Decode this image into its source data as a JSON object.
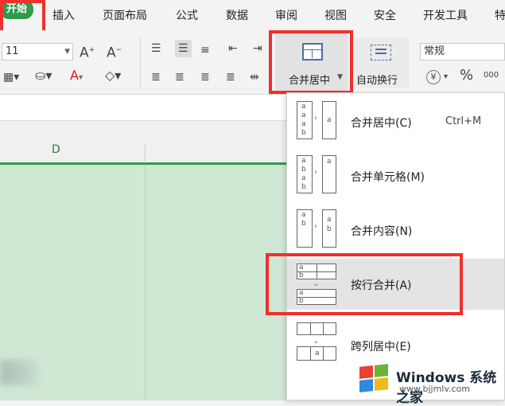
{
  "tabs": [
    {
      "id": "start",
      "label": "开始",
      "active": true
    },
    {
      "id": "insert",
      "label": "插入"
    },
    {
      "id": "layout",
      "label": "页面布局"
    },
    {
      "id": "formula",
      "label": "公式"
    },
    {
      "id": "data",
      "label": "数据"
    },
    {
      "id": "review",
      "label": "审阅"
    },
    {
      "id": "view",
      "label": "视图"
    },
    {
      "id": "security",
      "label": "安全"
    },
    {
      "id": "dev",
      "label": "开发工具"
    },
    {
      "id": "more",
      "label": "特"
    }
  ],
  "ribbon": {
    "font_size": "11",
    "number_format": "常规",
    "merge_center_label": "合并居中",
    "wrap_text_label": "自动换行",
    "percent_label": "%",
    "currency_label": "¥"
  },
  "column_header": "D",
  "menu": {
    "items": [
      {
        "label": "合并居中(C)",
        "shortcut": "Ctrl+M"
      },
      {
        "label": "合并单元格(M)",
        "shortcut": ""
      },
      {
        "label": "合并内容(N)",
        "shortcut": ""
      },
      {
        "label": "按行合并(A)",
        "shortcut": ""
      },
      {
        "label": "跨列居中(E)",
        "shortcut": ""
      }
    ],
    "icon_letters": [
      "a",
      "b"
    ]
  },
  "watermark": {
    "title": "Windows 系统之家",
    "url": "www.bjjmlv.com"
  },
  "colors": {
    "accent": "#2e9a4a",
    "highlight": "#f0302c",
    "sheet_bg": "#cfe8d4"
  }
}
